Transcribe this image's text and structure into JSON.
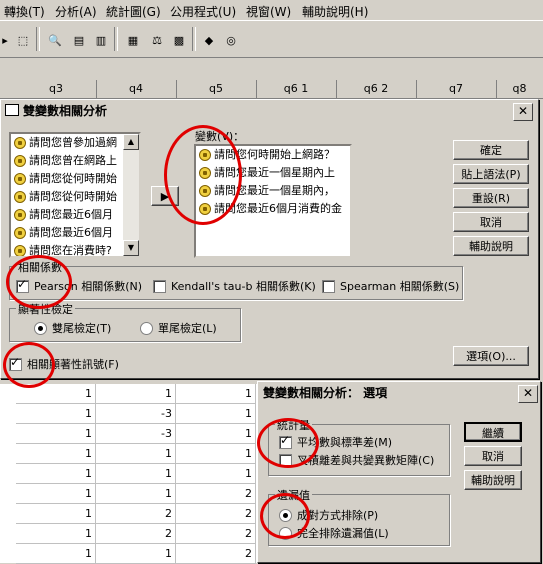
{
  "menu": [
    "轉換(T)",
    "分析(A)",
    "統計圖(G)",
    "公用程式(U)",
    "視窗(W)",
    "輔助說明(H)"
  ],
  "columns": [
    "q3",
    "q4",
    "q5",
    "q6 1",
    "q6 2",
    "q7",
    "q8"
  ],
  "grid_rows": [
    [
      "1",
      "1",
      "1"
    ],
    [
      "1",
      "-3",
      "1"
    ],
    [
      "1",
      "-3",
      "1"
    ],
    [
      "1",
      "1",
      "1"
    ],
    [
      "1",
      "1",
      "1"
    ],
    [
      "1",
      "1",
      "2"
    ],
    [
      "1",
      "2",
      "2"
    ],
    [
      "1",
      "2",
      "2"
    ],
    [
      "1",
      "1",
      "2"
    ]
  ],
  "main_dialog": {
    "title": "雙變數相關分析",
    "source_vars": [
      "請問您曾參加過網",
      "請問您曾在網路上",
      "請問您從何時開始",
      "請問您從何時開始",
      "請問您最近6個月",
      "請問您最近6個月",
      "請問您在消費時?"
    ],
    "target_label": "變數(V)：",
    "target_vars": [
      "請問您何時開始上網路？",
      "請問您最近一個星期內上",
      "請問您最近一個星期內，",
      "請問您最近6個月消費的金"
    ],
    "buttons": [
      "確定",
      "貼上語法(P)",
      "重設(R)",
      "取消",
      "輔助說明"
    ],
    "options_button": "選項(O)...",
    "coef_group": "相關係數",
    "coef": [
      {
        "label": "Pearson 相關係數(N)",
        "checked": true
      },
      {
        "label": "Kendall's tau-b 相關係數(K)",
        "checked": false
      },
      {
        "label": "Spearman 相關係數(S)",
        "checked": false
      }
    ],
    "test_group": "顯著性檢定",
    "tests": [
      {
        "label": "雙尾檢定(T)",
        "checked": true
      },
      {
        "label": "單尾檢定(L)",
        "checked": false
      }
    ],
    "flag_label": "相關顯著性訊號(F)",
    "flag_checked": true
  },
  "options_dialog": {
    "title": "雙變數相關分析： 選項",
    "stats_group": "統計量",
    "stats": [
      {
        "label": "平均數與標準差(M)",
        "checked": true
      },
      {
        "label": "叉積離差與共變異數矩陣(C)",
        "checked": false
      }
    ],
    "missing_group": "遺漏值",
    "missing": [
      {
        "label": "成對方式排除(P)",
        "checked": true
      },
      {
        "label": "完全排除遺漏值(L)",
        "checked": false
      }
    ],
    "buttons": [
      "繼續",
      "取消",
      "輔助說明"
    ]
  },
  "colors": {
    "annotation": "#e00000",
    "face": "#d4d0c8"
  }
}
